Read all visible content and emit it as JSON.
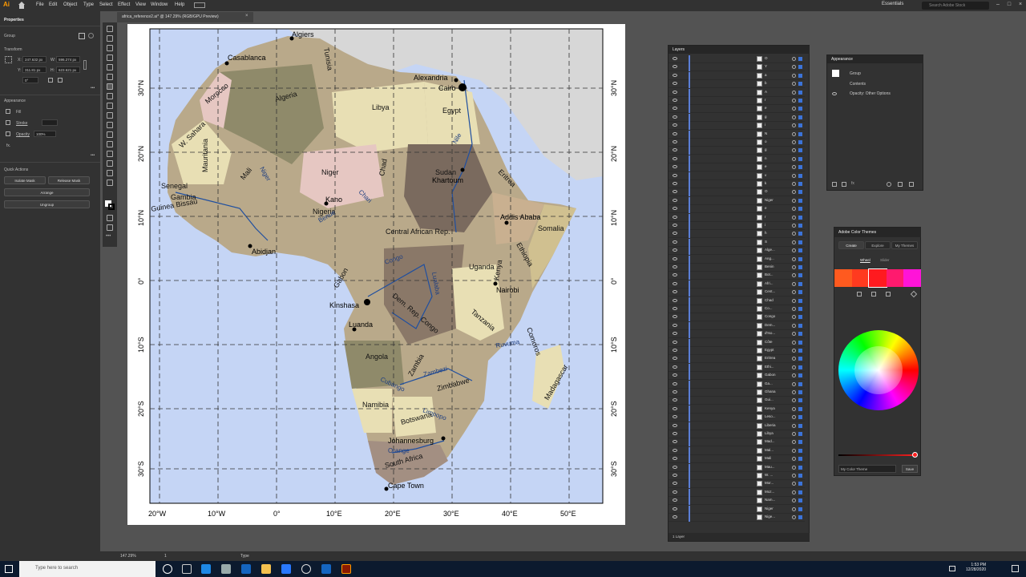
{
  "app": {
    "logo": "Ai",
    "workspace": "Essentials",
    "stock_search_placeholder": "Search Adobe Stock"
  },
  "menu": [
    "File",
    "Edit",
    "Object",
    "Type",
    "Select",
    "Effect",
    "View",
    "Window",
    "Help"
  ],
  "document_tab": {
    "label": "africa_reference2.ai* @ 147.29% (RGB/GPU Preview)"
  },
  "properties": {
    "title": "Properties",
    "group_label": "Group",
    "transform_label": "Transform",
    "x_label": "X:",
    "x_value": "247.632 px",
    "y_label": "Y:",
    "y_value": "311.81 px",
    "w_label": "W:",
    "w_value": "596.274 px",
    "h_label": "H:",
    "h_value": "623.621 px",
    "angle_value": "0°",
    "appearance_label": "Appearance",
    "fill_label": "Fill",
    "stroke_label": "Stroke",
    "opacity_label": "Opacity",
    "opacity_value": "100%",
    "fx_label": "fx.",
    "quick_actions_label": "Quick Actions",
    "isolate_btn": "Isolate Mask",
    "release_btn": "Release Mask",
    "arrange_btn": "Arrange",
    "ungroup_btn": "Ungroup"
  },
  "map": {
    "lat_labels": [
      "30°N",
      "20°N",
      "10°N",
      "0°",
      "10°S",
      "20°S",
      "30°S"
    ],
    "lon_labels": [
      "20°W",
      "10°W",
      "0°",
      "10°E",
      "20°E",
      "30°E",
      "40°E",
      "50°E"
    ],
    "countries": [
      "Algeria",
      "Libya",
      "Egypt",
      "Morocco",
      "Tunisia",
      "W. Sahara",
      "Mauritania",
      "Mali",
      "Niger",
      "Chad",
      "Sudan",
      "Ethiopia",
      "Somalia",
      "Kenya",
      "Tanzania",
      "Senegal",
      "Gambia",
      "Guinea Bissau",
      "Nigeria",
      "Central African Rep.",
      "Dem. Rep. Congo",
      "Angola",
      "Namibia",
      "Botswana",
      "Zimbabwe",
      "Zambia",
      "South Africa",
      "Madagascar",
      "Uganda",
      "Gabon",
      "Comoros",
      "Eritrea"
    ],
    "cities": [
      "Algiers",
      "Casablanca",
      "Alexandria",
      "Cairo",
      "Khartoum",
      "Addis Ababa",
      "Nairobi",
      "Kano",
      "Abidjan",
      "Kinshasa",
      "Luanda",
      "Johannesburg",
      "Cape Town"
    ],
    "rivers": [
      "Nile",
      "Niger",
      "Congo",
      "Zambezi",
      "Orange",
      "Limpopo",
      "Ruvuma",
      "Cubango",
      "Benue",
      "Chari",
      "Lualaba"
    ]
  },
  "layers": {
    "title": "Layers",
    "items": [
      "O",
      "Y",
      "a",
      "b",
      "A",
      "r",
      "e",
      "g",
      "i",
      "N",
      "o",
      "g",
      "n",
      "e",
      "v",
      "k",
      "O",
      "Niger",
      "e",
      "r",
      "i",
      "h",
      "S",
      "Alge...",
      "Ang...",
      "Benin",
      "Bot...",
      "Afri...",
      "Cent...",
      "Chad",
      "Co...",
      "Congo",
      "Dem...",
      "d'Iso...",
      "Côte",
      "Egypt",
      "Eritrea",
      "Ethi...",
      "Gabon",
      "Ga...",
      "Ghana",
      "Gui...",
      "Kenya",
      "Leso...",
      "Liberia",
      "Libya",
      "Mad...",
      "Mal...",
      "Mali",
      "Mau...",
      "W. ...",
      "Mor...",
      "Moz...",
      "Nam...",
      "Niger",
      "Nige..."
    ],
    "footer": "1 Layer"
  },
  "appearance": {
    "title": "Appearance",
    "group_label": "Group",
    "contents_label": "Contents",
    "opacity_text": "Opacity: Other Options"
  },
  "color_themes": {
    "title": "Adobe Color Themes",
    "tabs": [
      "Create",
      "Explore",
      "My Themes"
    ],
    "subtabs": [
      "Wheel",
      "Slider"
    ],
    "swatches": [
      "#ff5a1f",
      "#ff3a1f",
      "#ff1a1f",
      "#ff1a6e",
      "#ff14d8"
    ],
    "theme_name": "My Color Theme",
    "save_btn": "Save"
  },
  "status": {
    "zoom": "147.29%",
    "artboard": "1",
    "tool": "Type"
  },
  "taskbar": {
    "search_placeholder": "Type here to search",
    "time": "1:53 PM",
    "date": "12/28/2020"
  }
}
